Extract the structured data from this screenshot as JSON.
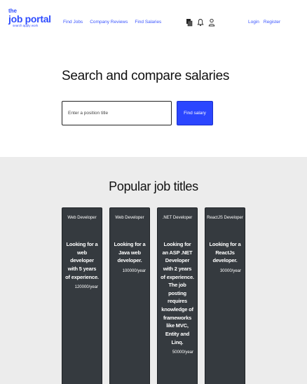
{
  "header": {
    "logo_the": "the",
    "logo_name": "job portal",
    "logo_tagline": "search apply work",
    "nav": [
      {
        "label": "Find Jobs"
      },
      {
        "label": "Company Reviews"
      },
      {
        "label": "Find Salaries"
      }
    ],
    "auth": {
      "login": "Login",
      "register": "Register"
    }
  },
  "hero": {
    "title": "Search and compare salaries",
    "search_placeholder": "Enter a position title",
    "button_label": "Find salary"
  },
  "popular": {
    "title": "Popular job titles",
    "cards": [
      {
        "title": "Web Developer",
        "body": "Looking for a web developer with 5 years of experience.",
        "salary": "120000/year"
      },
      {
        "title": "Web Developer",
        "body": "Looking for a Java web developer.",
        "salary": "100000/year"
      },
      {
        "title": ".NET Developer",
        "body": "Looking for an ASP .NET Developer with 2 years of experience. The job posting requires knowledge of frameworks like MVC, Entity and Linq.",
        "salary": "50000/year"
      },
      {
        "title": "ReactJS Developer",
        "body": "Looking for a ReactJs developer.",
        "salary": "30000/year"
      }
    ]
  },
  "colors": {
    "brand": "#2b46ff",
    "card_bg": "#353a3f",
    "section_bg": "#ececec"
  }
}
